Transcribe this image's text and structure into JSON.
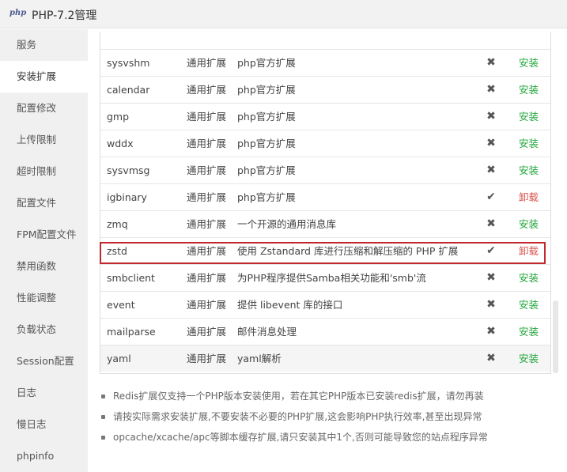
{
  "window": {
    "logo": "php",
    "title": "PHP-7.2管理"
  },
  "sidebar": {
    "items": [
      {
        "label": "服务"
      },
      {
        "label": "安装扩展",
        "active": true
      },
      {
        "label": "配置修改"
      },
      {
        "label": "上传限制"
      },
      {
        "label": "超时限制"
      },
      {
        "label": "配置文件"
      },
      {
        "label": "FPM配置文件"
      },
      {
        "label": "禁用函数"
      },
      {
        "label": "性能调整"
      },
      {
        "label": "负载状态"
      },
      {
        "label": "Session配置"
      },
      {
        "label": "日志"
      },
      {
        "label": "慢日志"
      },
      {
        "label": "phpinfo"
      }
    ]
  },
  "extensions": {
    "rows": [
      {
        "name": "sysvshm",
        "type": "通用扩展",
        "desc": "php官方扩展",
        "status_icon": "cross-icon",
        "status_glyph": "✖",
        "action": "安装"
      },
      {
        "name": "calendar",
        "type": "通用扩展",
        "desc": "php官方扩展",
        "status_icon": "cross-icon",
        "status_glyph": "✖",
        "action": "安装"
      },
      {
        "name": "gmp",
        "type": "通用扩展",
        "desc": "php官方扩展",
        "status_icon": "cross-icon",
        "status_glyph": "✖",
        "action": "安装"
      },
      {
        "name": "wddx",
        "type": "通用扩展",
        "desc": "php官方扩展",
        "status_icon": "cross-icon",
        "status_glyph": "✖",
        "action": "安装"
      },
      {
        "name": "sysvmsg",
        "type": "通用扩展",
        "desc": "php官方扩展",
        "status_icon": "cross-icon",
        "status_glyph": "✖",
        "action": "安装"
      },
      {
        "name": "igbinary",
        "type": "通用扩展",
        "desc": "php官方扩展",
        "status_icon": "check-icon",
        "status_glyph": "✔",
        "action": "卸载"
      },
      {
        "name": "zmq",
        "type": "通用扩展",
        "desc": "一个开源的通用消息库",
        "status_icon": "cross-icon",
        "status_glyph": "✖",
        "action": "安装"
      },
      {
        "name": "zstd",
        "type": "通用扩展",
        "desc": "使用 Zstandard 库进行压缩和解压缩的 PHP 扩展",
        "status_icon": "check-icon",
        "status_glyph": "✔",
        "action": "卸载"
      },
      {
        "name": "smbclient",
        "type": "通用扩展",
        "desc": "为PHP程序提供Samba相关功能和'smb'流",
        "status_icon": "cross-icon",
        "status_glyph": "✖",
        "action": "安装"
      },
      {
        "name": "event",
        "type": "通用扩展",
        "desc": "提供 libevent 库的接口",
        "status_icon": "cross-icon",
        "status_glyph": "✖",
        "action": "安装"
      },
      {
        "name": "mailparse",
        "type": "通用扩展",
        "desc": "邮件消息处理",
        "status_icon": "cross-icon",
        "status_glyph": "✖",
        "action": "安装"
      },
      {
        "name": "yaml",
        "type": "通用扩展",
        "desc": "yaml解析",
        "status_icon": "cross-icon",
        "status_glyph": "✖",
        "action": "安装"
      }
    ]
  },
  "notes": [
    "Redis扩展仅支持一个PHP版本安装使用，若在其它PHP版本已安装redis扩展，请勿再装",
    "请按实际需求安装扩展,不要安装不必要的PHP扩展,这会影响PHP执行效率,甚至出现异常",
    "opcache/xcache/apc等脚本缓存扩展,请只安装其中1个,否则可能导致您的站点程序异常"
  ],
  "colors": {
    "install": "#20a53a",
    "uninstall": "#d9534f",
    "highlight": "#c0282d"
  }
}
